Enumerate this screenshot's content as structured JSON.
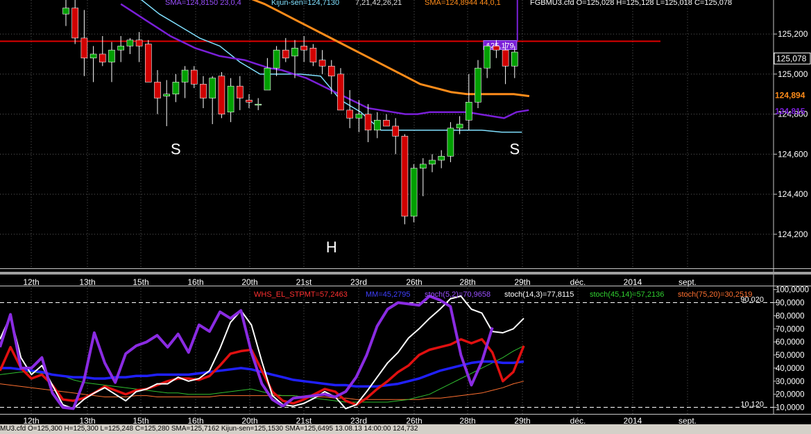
{
  "header": {
    "sma_purple": "SMA=124,8150  23,0,4",
    "kijun": "Kijun-sen=124,7130",
    "kijun_params": "7,21,42,26,21",
    "sma_orange": "SMA=124,8944  44,0,1",
    "ohlc": "FGBMU3.cfd O=125,028 H=125,128 L=125,018 C=125,078"
  },
  "osc_header": {
    "whs": "WHS_EL_STPMT=57,2463",
    "mm": "MM=45,2795",
    "stoch52": "stoch(5,2)=70,9658",
    "stoch143": "stoch(14,3)=77,8115",
    "stoch4514": "stoch(45,14)=57,2136",
    "stoch7520": "stoch(75,20)=30,2519"
  },
  "bottom_bar": "MU3.cfd O=125,300 H=125,300 L=125,248 C=125,280 SMA=125,7162 Kijun-sen=125,1530 SMA=125,6495 13.08.13 14:00:00 124,732",
  "colors": {
    "up": "#00a000",
    "down": "#d00000",
    "sma_fast": "#7a1fd8",
    "sma_slow": "#ff8c1a",
    "kijun": "#80e0ff",
    "resistance": "#e00000",
    "grid": "#5a5a5a"
  },
  "chart_data": [
    {
      "type": "candlestick",
      "panel": "price",
      "ylim": [
        124.03,
        125.37
      ],
      "y_ticks": [
        "125,200",
        "125,000",
        "124,800",
        "124,600",
        "124,400",
        "124,200"
      ],
      "price_badges": [
        {
          "label": "125,078",
          "value": 125.078,
          "style": "box"
        },
        {
          "label": "124,894",
          "value": 124.894,
          "color": "#ff8c1a"
        },
        {
          "label": "124,815",
          "value": 124.815,
          "color": "#7a1fd8"
        }
      ],
      "resistance": {
        "value": 125.164,
        "label": "125,179"
      },
      "x_ticks": [
        "12th",
        "13th",
        "15th",
        "16th",
        "20th",
        "21st",
        "23rd",
        "26th",
        "28th",
        "29th",
        "déc.",
        "2014",
        "sept."
      ],
      "annotations": [
        {
          "text": "S",
          "i": 12,
          "value": 124.6
        },
        {
          "text": "H",
          "i": 29,
          "value": 124.11
        },
        {
          "text": "S",
          "i": 49,
          "value": 124.6
        }
      ],
      "candles": [
        [
          125.3,
          125.38,
          125.24,
          125.33
        ],
        [
          125.33,
          125.4,
          125.15,
          125.18
        ],
        [
          125.18,
          125.32,
          124.99,
          125.08
        ],
        [
          125.08,
          125.14,
          124.96,
          125.1
        ],
        [
          125.1,
          125.19,
          125.04,
          125.06
        ],
        [
          125.06,
          125.16,
          124.96,
          125.12
        ],
        [
          125.12,
          125.19,
          125.06,
          125.14
        ],
        [
          125.14,
          125.18,
          125.1,
          125.17
        ],
        [
          125.17,
          125.21,
          125.06,
          125.14
        ],
        [
          125.15,
          125.17,
          124.97,
          124.96
        ],
        [
          124.96,
          125.02,
          124.8,
          124.88
        ],
        [
          124.89,
          124.97,
          124.74,
          124.9
        ],
        [
          124.9,
          125.0,
          124.86,
          124.96
        ],
        [
          124.96,
          125.04,
          124.88,
          125.02
        ],
        [
          125.02,
          125.04,
          124.93,
          124.95
        ],
        [
          124.95,
          124.99,
          124.83,
          124.88
        ],
        [
          124.88,
          124.99,
          124.75,
          124.98
        ],
        [
          124.99,
          125.01,
          124.78,
          124.8
        ],
        [
          124.81,
          124.98,
          124.76,
          124.94
        ],
        [
          124.94,
          124.99,
          124.82,
          124.88
        ],
        [
          124.87,
          124.9,
          124.83,
          124.86
        ],
        [
          124.85,
          124.88,
          124.82,
          124.85
        ],
        [
          124.92,
          125.08,
          124.94,
          125.03
        ],
        [
          125.03,
          125.14,
          124.99,
          125.12
        ],
        [
          125.12,
          125.18,
          125.06,
          125.08
        ],
        [
          125.09,
          125.17,
          124.98,
          125.13
        ],
        [
          125.14,
          125.19,
          125.06,
          125.12
        ],
        [
          125.13,
          125.15,
          125.04,
          125.06
        ],
        [
          125.07,
          125.12,
          125.0,
          125.04
        ],
        [
          125.04,
          125.07,
          124.9,
          124.99
        ],
        [
          125.0,
          125.03,
          124.82,
          124.82
        ],
        [
          124.82,
          124.92,
          124.73,
          124.78
        ],
        [
          124.78,
          124.87,
          124.71,
          124.8
        ],
        [
          124.8,
          124.85,
          124.66,
          124.72
        ],
        [
          124.72,
          124.81,
          124.68,
          124.77
        ],
        [
          124.77,
          124.8,
          124.74,
          124.74
        ],
        [
          124.74,
          124.78,
          124.6,
          124.69
        ],
        [
          124.69,
          124.7,
          124.25,
          124.29
        ],
        [
          124.29,
          124.55,
          124.26,
          124.53
        ],
        [
          124.53,
          124.58,
          124.39,
          124.55
        ],
        [
          124.55,
          124.6,
          124.51,
          124.57
        ],
        [
          124.57,
          124.62,
          124.53,
          124.59
        ],
        [
          124.59,
          124.76,
          124.56,
          124.73
        ],
        [
          124.73,
          124.79,
          124.7,
          124.75
        ],
        [
          124.77,
          125.0,
          124.72,
          124.86
        ],
        [
          124.86,
          125.07,
          124.83,
          125.03
        ],
        [
          125.03,
          125.15,
          124.98,
          125.14
        ],
        [
          125.14,
          125.17,
          125.08,
          125.12
        ],
        [
          125.12,
          125.16,
          124.95,
          125.04
        ],
        [
          125.04,
          125.14,
          124.98,
          125.11
        ]
      ],
      "sma_fast": [
        125.35,
        125.31,
        125.27,
        125.23,
        125.19,
        125.16,
        125.13,
        125.11,
        125.09,
        125.08,
        125.07,
        125.05,
        125.03,
        125.02,
        125.0,
        124.98,
        124.95,
        124.92,
        124.89,
        124.86,
        124.83,
        124.82,
        124.81,
        124.8,
        124.8,
        124.81,
        124.81,
        124.81,
        124.81,
        124.8,
        124.79,
        124.78,
        124.81,
        124.82
      ],
      "sma_slow": [
        125.38,
        125.35,
        125.31,
        125.27,
        125.23,
        125.19,
        125.15,
        125.11,
        125.07,
        125.03,
        124.99,
        124.95,
        124.93,
        124.91,
        124.9,
        124.9,
        124.9,
        124.9,
        124.89
      ],
      "kijun": [
        125.38,
        125.3,
        125.24,
        125.18,
        125.14,
        125.06,
        125.0,
        125.0,
        125.0,
        124.99,
        124.87,
        124.81,
        124.72,
        124.72,
        124.72,
        124.72,
        124.72,
        124.72,
        124.71,
        124.71
      ]
    },
    {
      "type": "line",
      "panel": "oscillator",
      "ylim": [
        5,
        103
      ],
      "y_ticks": [
        "100,0000",
        "90,0000",
        "80,0000",
        "70,0000",
        "60,0000",
        "50,0000",
        "40,0000",
        "30,0000",
        "20,0000",
        "10,0000"
      ],
      "levels": [
        {
          "value": 90,
          "label": "90,020"
        },
        {
          "value": 10,
          "label": "10,120"
        }
      ],
      "x_ticks": [
        "12th",
        "13th",
        "15th",
        "16th",
        "20th",
        "21st",
        "23rd",
        "26th",
        "28th",
        "29th",
        "déc.",
        "2014",
        "sept."
      ],
      "series": [
        {
          "name": "stoch(75,20)",
          "color": "#ff7030",
          "width": 1,
          "values": [
            28,
            27,
            26,
            25,
            24,
            23,
            22,
            21,
            20,
            19,
            18,
            18,
            18,
            19,
            19,
            18,
            18,
            18,
            18,
            18,
            18,
            19,
            19,
            19,
            19,
            19,
            19,
            19,
            19,
            18,
            18,
            18,
            17,
            17,
            16,
            16,
            16,
            16,
            16,
            16,
            16,
            17,
            17,
            18,
            19,
            20,
            21,
            23,
            25,
            28,
            30
          ]
        },
        {
          "name": "stoch(45,14)",
          "color": "#30c030",
          "width": 1,
          "values": [
            35,
            36,
            37,
            37,
            36,
            35,
            34,
            31,
            29,
            28,
            27,
            26,
            25,
            24,
            23,
            22,
            21,
            21,
            20,
            20,
            20,
            21,
            22,
            23,
            24,
            22,
            20,
            19,
            19,
            18,
            17,
            16,
            15,
            14,
            14,
            14,
            14,
            14,
            15,
            16,
            18,
            20,
            24,
            28,
            32,
            36,
            40,
            44,
            48,
            53,
            57
          ]
        },
        {
          "name": "MM",
          "color": "#2020ff",
          "width": 3.5,
          "values": [
            40,
            40,
            39,
            38,
            37,
            35,
            34,
            33,
            33,
            32,
            32,
            33,
            33,
            34,
            34,
            35,
            35,
            35,
            35,
            36,
            37,
            38,
            39,
            40,
            39,
            37,
            35,
            33,
            31,
            30,
            29,
            28,
            27,
            27,
            26,
            26,
            26,
            27,
            28,
            30,
            32,
            35,
            38,
            40,
            42,
            44,
            45,
            45,
            44,
            44,
            45
          ]
        },
        {
          "name": "WHS_EL_STPMT",
          "color": "#e01010",
          "width": 3.5,
          "values": [
            38,
            56,
            40,
            32,
            35,
            27,
            16,
            15,
            17,
            21,
            26,
            23,
            20,
            23,
            24,
            27,
            30,
            32,
            32,
            31,
            34,
            42,
            51,
            53,
            54,
            38,
            22,
            15,
            13,
            16,
            20,
            24,
            22,
            15,
            12,
            17,
            24,
            30,
            37,
            42,
            50,
            54,
            56,
            58,
            62,
            59,
            62,
            52,
            30,
            37,
            57
          ]
        },
        {
          "name": "stoch(14,3)",
          "color": "#ffffff",
          "width": 2,
          "values": [
            62,
            80,
            48,
            35,
            42,
            27,
            12,
            9,
            16,
            21,
            25,
            20,
            15,
            22,
            24,
            28,
            28,
            33,
            30,
            32,
            38,
            55,
            75,
            84,
            73,
            45,
            19,
            12,
            11,
            13,
            17,
            22,
            18,
            9,
            12,
            22,
            33,
            44,
            52,
            63,
            70,
            78,
            85,
            93,
            95,
            85,
            82,
            68,
            67,
            70,
            78
          ]
        },
        {
          "name": "stoch(5,2)",
          "color": "#8a2be2",
          "width": 4,
          "values": [
            56,
            81,
            40,
            40,
            48,
            21,
            10,
            9,
            30,
            67,
            44,
            29,
            51,
            57,
            60,
            65,
            56,
            66,
            52,
            73,
            68,
            83,
            78,
            84,
            52,
            28,
            16,
            11,
            17,
            18,
            19,
            20,
            18,
            22,
            33,
            50,
            72,
            85,
            90,
            89,
            88,
            95,
            92,
            87,
            50,
            27,
            45,
            71
          ]
        }
      ]
    }
  ]
}
